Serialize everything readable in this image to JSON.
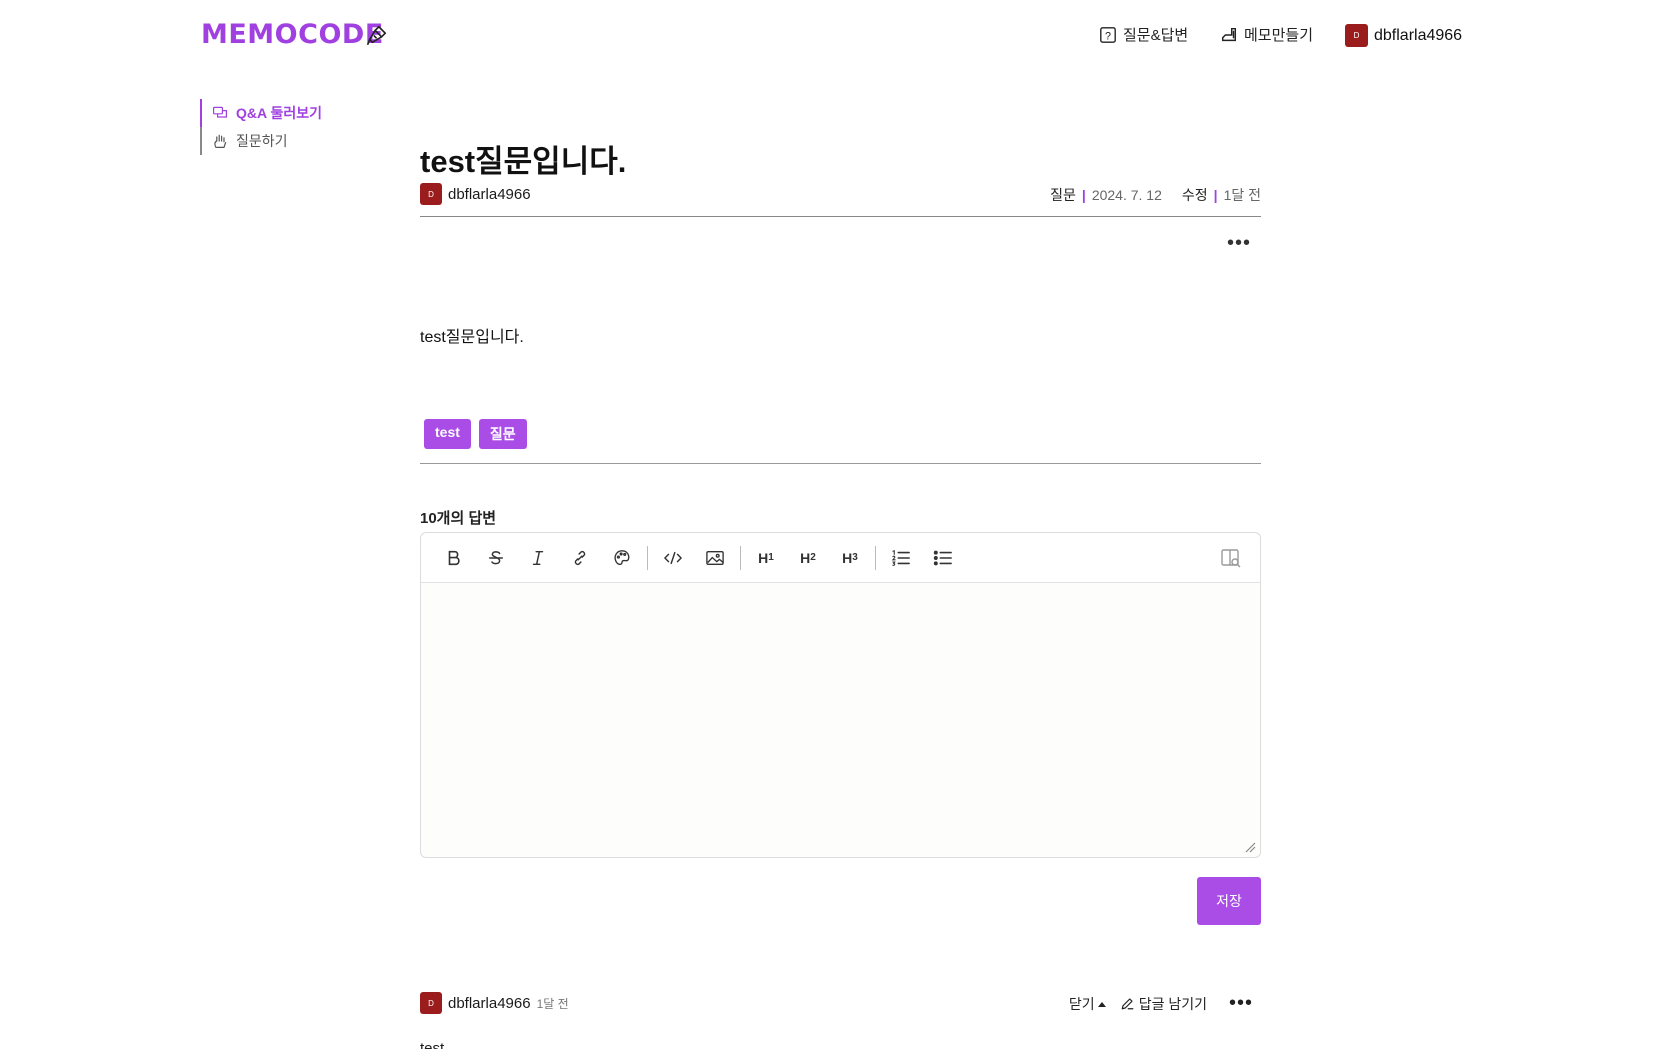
{
  "header": {
    "logo": "MEMOCODE",
    "logo_icon": "pen-icon",
    "nav": {
      "qa_label": "질문&답변",
      "memo_label": "메모만들기",
      "user_avatar_letter": "D",
      "username": "dbflarla4966"
    }
  },
  "sidebar": {
    "items": [
      {
        "label": "Q&A 둘러보기",
        "icon": "chat-icon",
        "active": true
      },
      {
        "label": "질문하기",
        "icon": "raise-hand-icon",
        "active": false
      }
    ]
  },
  "post": {
    "title": "test질문입니다.",
    "author": "dbflarla4966",
    "author_avatar_letter": "D",
    "kind": "질문",
    "date": "2024. 7. 12",
    "edited_label": "수정",
    "edited_ago": "1달 전",
    "body": "test질문입니다.",
    "tags": [
      "test",
      "질문"
    ]
  },
  "answers": {
    "count_label": "10개의 답변"
  },
  "editor": {
    "save_label": "저장",
    "toolbar": {
      "h1": "H",
      "h2": "H",
      "h3": "H"
    }
  },
  "first_answer": {
    "author": "dbflarla4966",
    "avatar_letter": "D",
    "ago": "1달 전",
    "close_label": "닫기",
    "reply_label": "답글 남기기",
    "body": "test"
  },
  "colors": {
    "accent": "#a040e0",
    "tag_bg": "#a94de6",
    "avatar_bg": "#9b1c1c"
  }
}
